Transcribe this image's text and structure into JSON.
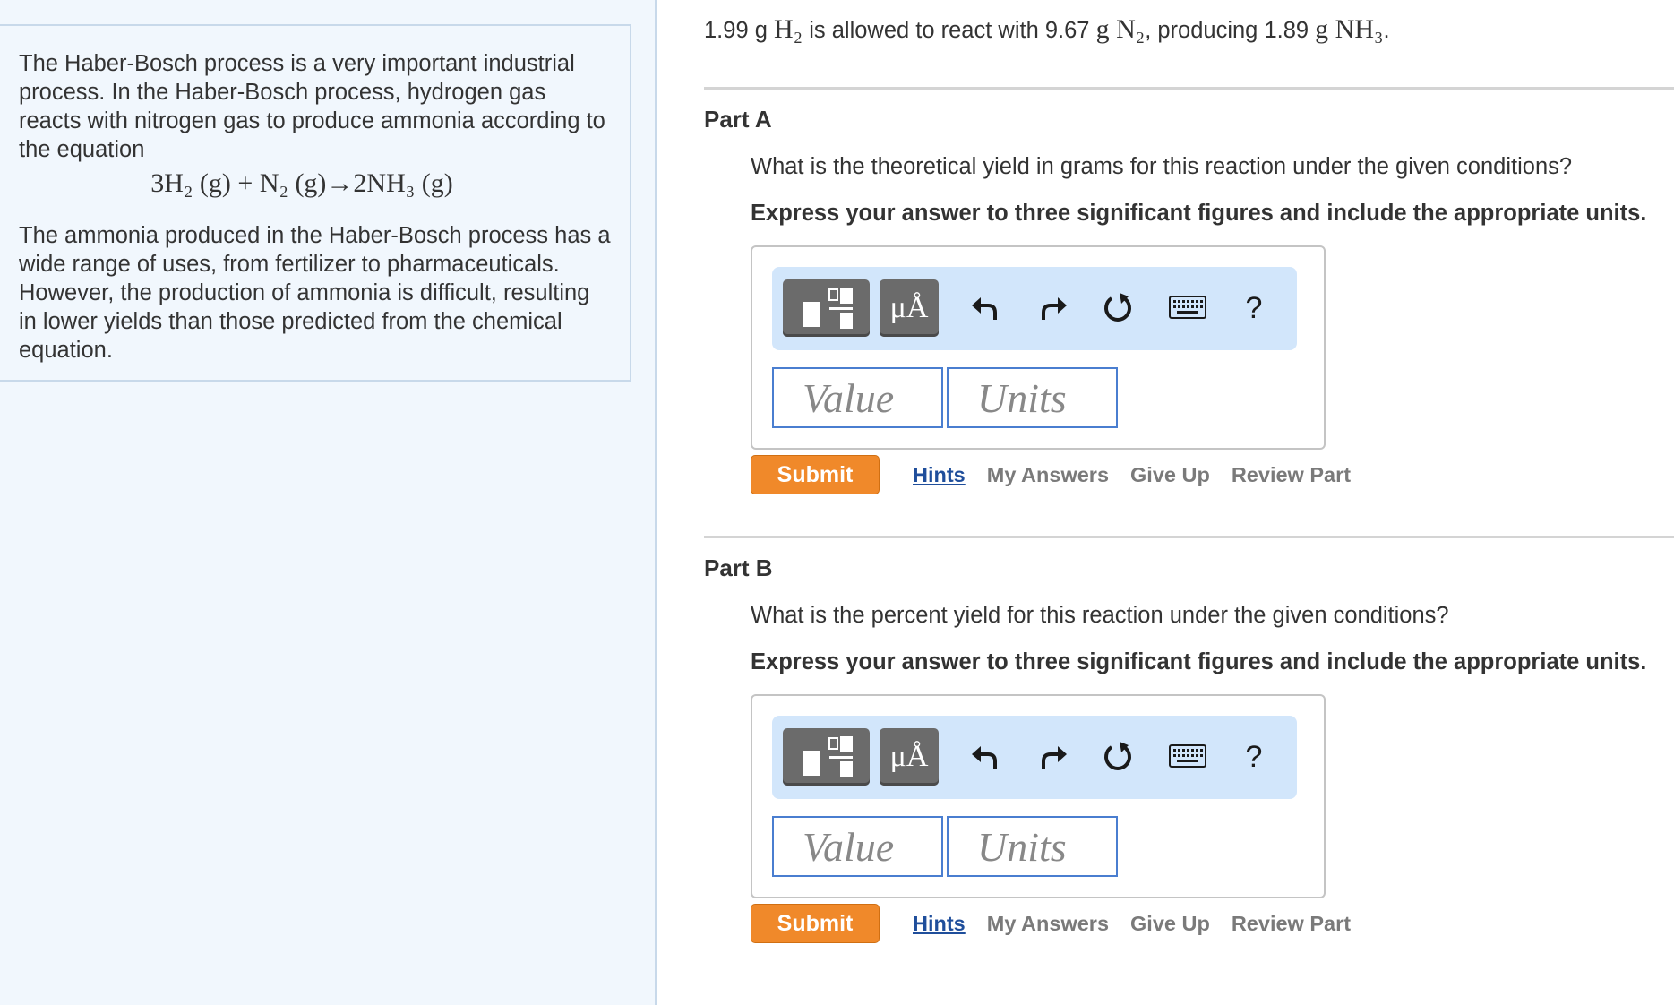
{
  "intro": {
    "paragraph1": "The Haber-Bosch process is a very important industrial process. In the Haber-Bosch process, hydrogen gas reacts with nitrogen gas to produce ammonia according to the equation",
    "equation": "3H₂ (g) + N₂ (g)→2NH₃ (g)",
    "paragraph2": "The ammonia produced in the Haber-Bosch process has a wide range of uses, from fertilizer to pharmaceuticals. However, the production of ammonia is difficult, resulting in lower yields than those predicted from the chemical equation."
  },
  "given": {
    "h2_mass": "1.99 g",
    "h2_formula": "H₂",
    "text1": "is allowed to react with 9.67",
    "n2_formula": "g N₂",
    "text2": ", producing 1.89",
    "nh3_formula": "g NH₃",
    "end": "."
  },
  "parts": [
    {
      "title": "Part A",
      "question": "What is the theoretical yield in grams for this reaction under the given conditions?",
      "instruction": "Express your answer to three significant figures and include the appropriate units."
    },
    {
      "title": "Part B",
      "question": "What is the percent yield for this reaction under the given conditions?",
      "instruction": "Express your answer to three significant figures and include the appropriate units."
    }
  ],
  "toolbar": {
    "units_label": "μÅ",
    "help_label": "?"
  },
  "inputs": {
    "value_placeholder": "Value",
    "units_placeholder": "Units"
  },
  "actions": {
    "submit": "Submit",
    "hints": "Hints",
    "my_answers": "My Answers",
    "give_up": "Give Up",
    "review_part": "Review Part"
  },
  "colors": {
    "submit": "#f0892a",
    "hints_link": "#1f4e9b",
    "toolbar_bg": "#d2e6fb",
    "left_pane_bg": "#f1f7fd",
    "input_border": "#4a7ed0"
  },
  "icons": {
    "templates": "templates-icon",
    "undo": "undo-icon",
    "redo": "redo-icon",
    "reset": "reset-icon",
    "keyboard": "keyboard-icon",
    "help": "help-icon"
  }
}
